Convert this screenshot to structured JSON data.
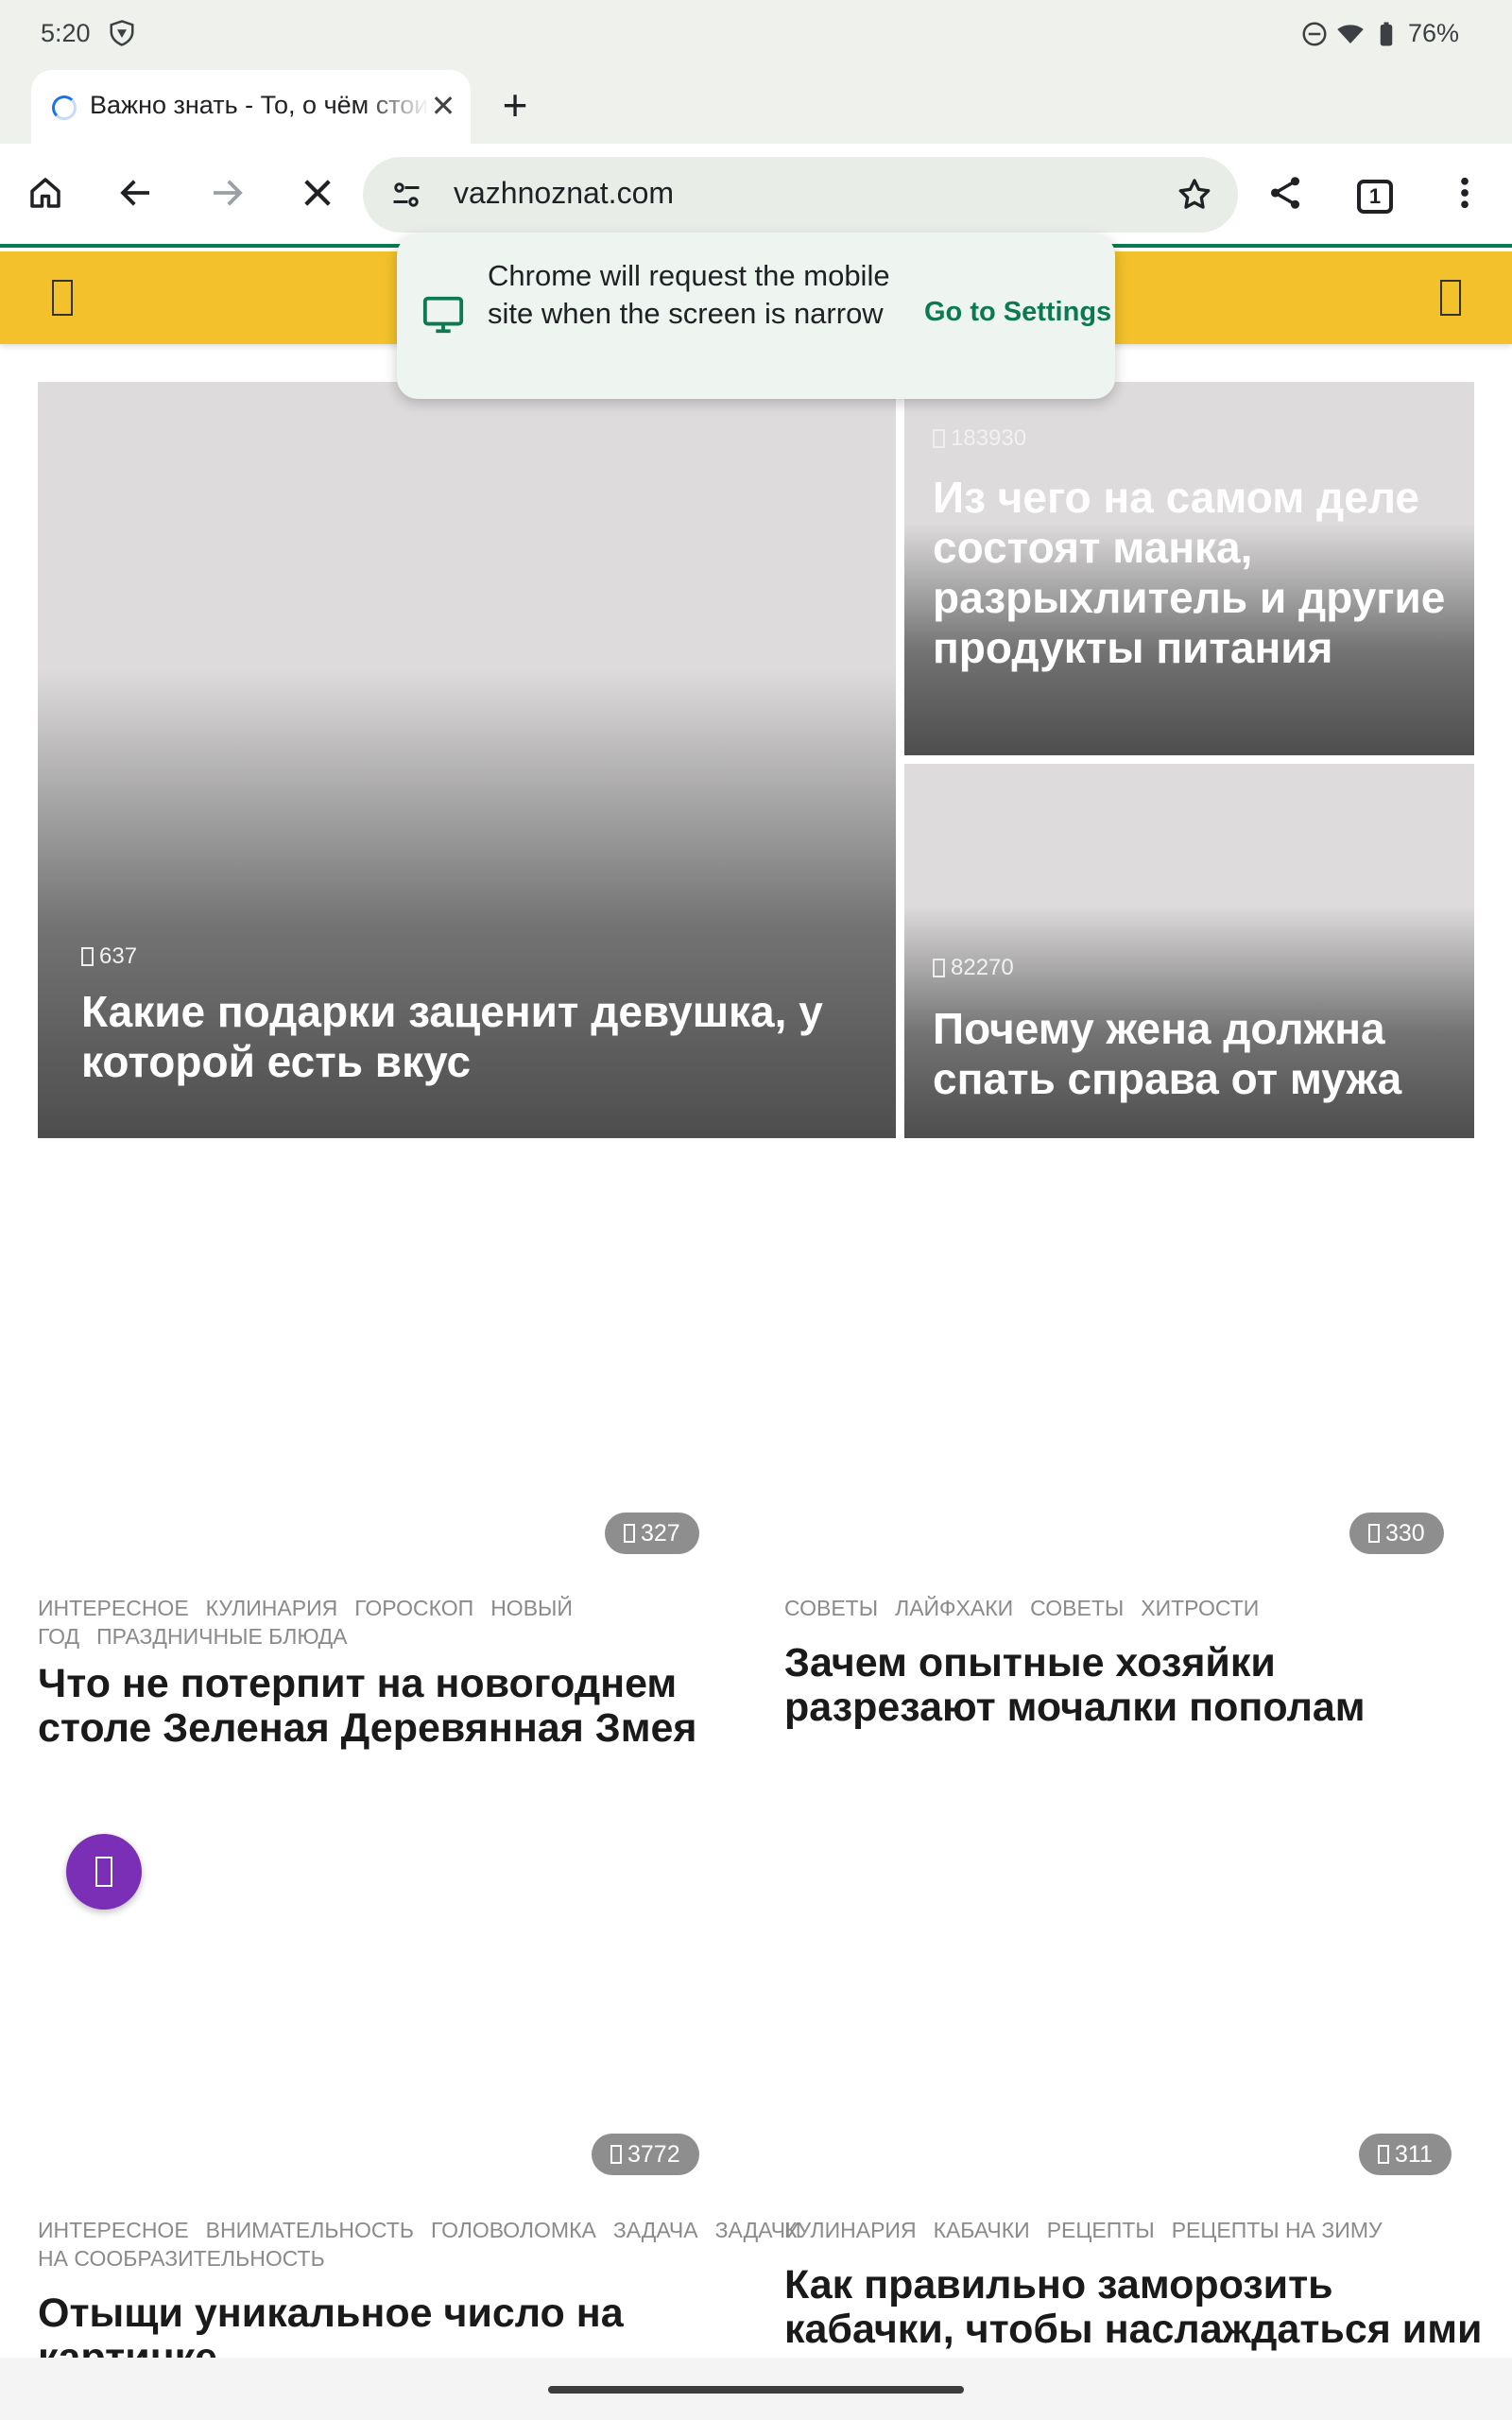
{
  "status_bar": {
    "time": "5:20",
    "battery": "76%"
  },
  "browser": {
    "tab_title": "Важно знать - То, о чём стоит знать",
    "new_tab_symbol": "+",
    "url": "vazhnoznat.com",
    "tab_count": "1",
    "accent_color": "#0b7a53"
  },
  "popup": {
    "message": "Chrome will request the mobile site when the screen is narrow",
    "action": "Go to Settings"
  },
  "site": {
    "header_color": "#f2c12b"
  },
  "hero": [
    {
      "views": "637",
      "title": "Какие подарки заценит девушка, у которой есть вкус"
    },
    {
      "views": "183930",
      "title": "Из чего на самом деле состоят манка, разрыхлитель и другие продукты питания"
    },
    {
      "views": "82270",
      "title": "Почему жена должна спать справа от мужа"
    }
  ],
  "articles": [
    {
      "badge": "327",
      "tags": [
        "Интересное",
        "Кулинария",
        "Гороскоп",
        "Новый год",
        "Праздничные блюда"
      ],
      "title": "Что не потерпит на новогоднем столе Зеленая Деревянная Змея"
    },
    {
      "badge": "330",
      "tags": [
        "Советы",
        "Лайфхаки",
        "Советы",
        "Хитрости"
      ],
      "title": "Зачем опытные хозяйки разрезают мочалки пополам"
    },
    {
      "badge": "3772",
      "tags": [
        "Интересное",
        "Внимательность",
        "Головоломка",
        "Задача",
        "Задачи на сообразительность"
      ],
      "title": "Отыщи уникальное число на картинке"
    },
    {
      "badge": "311",
      "tags": [
        "Кулинария",
        "Кабачки",
        "Рецепты",
        "Рецепты на зиму"
      ],
      "title": "Как правильно заморозить кабачки, чтобы наслаждаться ими всю зиму"
    }
  ]
}
